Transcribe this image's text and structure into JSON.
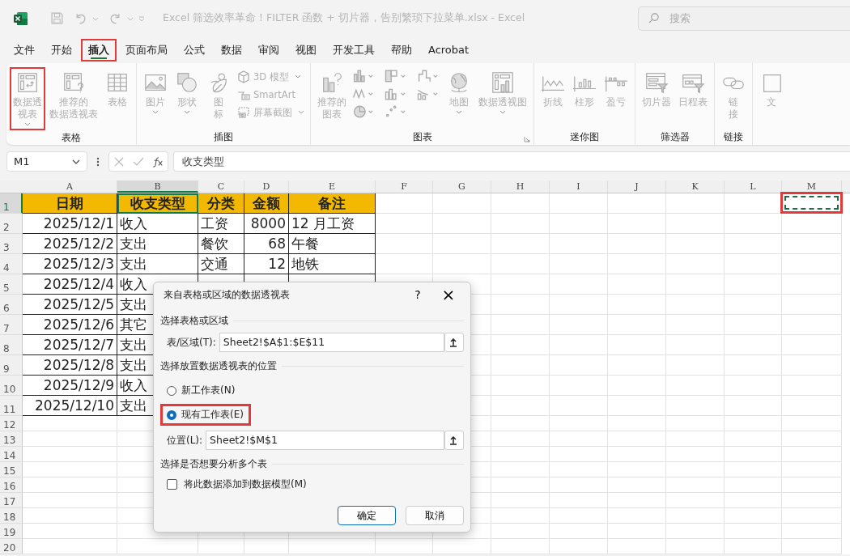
{
  "window": {
    "title": "Excel 筛选效率革命！FILTER 函数 + 切片器，告别繁琐下拉菜单.xlsx  -  Excel",
    "search_placeholder": "搜索"
  },
  "tabs": [
    {
      "label": "文件",
      "selected": false,
      "highlighted": false
    },
    {
      "label": "开始",
      "selected": false,
      "highlighted": false
    },
    {
      "label": "插入",
      "selected": true,
      "highlighted": true
    },
    {
      "label": "页面布局",
      "selected": false,
      "highlighted": false
    },
    {
      "label": "公式",
      "selected": false,
      "highlighted": false
    },
    {
      "label": "数据",
      "selected": false,
      "highlighted": false
    },
    {
      "label": "审阅",
      "selected": false,
      "highlighted": false
    },
    {
      "label": "视图",
      "selected": false,
      "highlighted": false
    },
    {
      "label": "开发工具",
      "selected": false,
      "highlighted": false
    },
    {
      "label": "帮助",
      "selected": false,
      "highlighted": false
    },
    {
      "label": "Acrobat",
      "selected": false,
      "highlighted": false
    }
  ],
  "ribbon": {
    "disabled": true,
    "groups": [
      {
        "label": "表格",
        "buttons": [
          {
            "lines": [
              "数据透",
              "视表"
            ],
            "dropdown": true,
            "highlighted": true
          },
          {
            "lines": [
              "推荐的",
              "数据透视表"
            ],
            "dropdown": false,
            "highlighted": false
          },
          {
            "lines": [
              "表格"
            ],
            "dropdown": false,
            "highlighted": false
          }
        ]
      },
      {
        "label": "插图",
        "buttons": [
          {
            "lines": [
              "图片"
            ],
            "dropdown": true,
            "highlighted": false
          },
          {
            "lines": [
              "形状"
            ],
            "dropdown": true,
            "highlighted": false
          },
          {
            "lines": [
              "图",
              "标"
            ],
            "dropdown": false,
            "highlighted": false
          }
        ],
        "small": [
          {
            "label": "3D 模型",
            "dropdown": true
          },
          {
            "label": "SmartArt",
            "dropdown": false
          },
          {
            "label": "屏幕截图",
            "dropdown": true
          }
        ]
      },
      {
        "label": "图表",
        "buttons": [
          {
            "lines": [
              "推荐的",
              "图表"
            ],
            "dropdown": false,
            "highlighted": false
          },
          {
            "lines": [
              "地图"
            ],
            "dropdown": true,
            "highlighted": false
          },
          {
            "lines": [
              "数据透视图"
            ],
            "dropdown": true,
            "highlighted": false
          }
        ]
      },
      {
        "label": "迷你图",
        "buttons": [
          {
            "lines": [
              "折线"
            ],
            "dropdown": false,
            "highlighted": false
          },
          {
            "lines": [
              "柱形"
            ],
            "dropdown": false,
            "highlighted": false
          },
          {
            "lines": [
              "盈亏"
            ],
            "dropdown": false,
            "highlighted": false
          }
        ]
      },
      {
        "label": "筛选器",
        "buttons": [
          {
            "lines": [
              "切片器"
            ],
            "dropdown": false,
            "highlighted": false
          },
          {
            "lines": [
              "日程表"
            ],
            "dropdown": false,
            "highlighted": false
          }
        ]
      },
      {
        "label": "链接",
        "buttons": [
          {
            "lines": [
              "链",
              "接"
            ],
            "dropdown": false,
            "highlighted": false
          }
        ]
      },
      {
        "buttons": [
          {
            "lines": [
              "文"
            ],
            "dropdown": false,
            "highlighted": false
          }
        ]
      }
    ]
  },
  "formula_bar": {
    "name_box": "M1",
    "formula": "收支类型"
  },
  "sheet": {
    "columns": [
      {
        "letter": "A",
        "kind": "date",
        "selected": false
      },
      {
        "letter": "B",
        "kind": "text",
        "selected": true
      },
      {
        "letter": "C",
        "kind": "text",
        "selected": false
      },
      {
        "letter": "D",
        "kind": "number",
        "selected": false
      },
      {
        "letter": "E",
        "kind": "text",
        "selected": false
      },
      {
        "letter": "F",
        "selected": false
      },
      {
        "letter": "G",
        "selected": false
      },
      {
        "letter": "H",
        "selected": false
      },
      {
        "letter": "I",
        "selected": false
      },
      {
        "letter": "J",
        "selected": false
      },
      {
        "letter": "K",
        "selected": false
      },
      {
        "letter": "L",
        "selected": false
      },
      {
        "letter": "M",
        "selected": false,
        "marquee": {
          "highlighted": true
        }
      }
    ],
    "rows": [
      {
        "number": "1",
        "selected": true,
        "header": true,
        "marquee": true,
        "cells": [
          "日期",
          "收支类型",
          "分类",
          "金额",
          "备注"
        ]
      },
      {
        "number": "2",
        "selected": false,
        "cells": [
          "2025/12/1",
          "收入",
          "工资",
          "8000",
          "12  月工资"
        ]
      },
      {
        "number": "3",
        "selected": false,
        "cells": [
          "2025/12/2",
          "支出",
          "餐饮",
          "68",
          "午餐"
        ]
      },
      {
        "number": "4",
        "selected": false,
        "cells": [
          "2025/12/3",
          "支出",
          "交通",
          "12",
          "地铁"
        ]
      },
      {
        "number": "5",
        "selected": false,
        "cells": [
          "2025/12/4",
          "收入"
        ]
      },
      {
        "number": "6",
        "selected": false,
        "cells": [
          "2025/12/5",
          "支出"
        ]
      },
      {
        "number": "7",
        "selected": false,
        "cells": [
          "2025/12/6",
          "其它"
        ]
      },
      {
        "number": "8",
        "selected": false,
        "cells": [
          "2025/12/7",
          "支出"
        ]
      },
      {
        "number": "9",
        "selected": false,
        "cells": [
          "2025/12/8",
          "支出"
        ]
      },
      {
        "number": "10",
        "selected": false,
        "cells": [
          "2025/12/9",
          "收入"
        ]
      },
      {
        "number": "11",
        "selected": false,
        "cells": [
          "2025/12/10",
          "支出"
        ]
      },
      {
        "number": "12",
        "selected": false
      },
      {
        "number": "13",
        "selected": false
      },
      {
        "number": "14",
        "selected": false
      },
      {
        "number": "15",
        "selected": false
      },
      {
        "number": "16",
        "selected": false
      },
      {
        "number": "17",
        "selected": false
      },
      {
        "number": "18",
        "selected": false
      },
      {
        "number": "19",
        "selected": false
      },
      {
        "number": "20",
        "selected": false
      }
    ]
  },
  "dialog": {
    "title": "来自表格或区域的数据透视表",
    "help": "?",
    "close": "×",
    "section_1": "选择表格或区域",
    "range_label": "表/区域(T):",
    "range_value": "Sheet2!$A$1:$E$11",
    "section_2": "选择放置数据透视表的位置",
    "options": [
      {
        "label": "新工作表(N)",
        "selected": false,
        "highlighted": false
      },
      {
        "label": "现有工作表(E)",
        "selected": true,
        "highlighted": true
      }
    ],
    "location_label": "位置(L):",
    "location_value": "Sheet2!$M$1",
    "section_3": "选择是否想要分析多个表",
    "checkbox": {
      "label": "将此数据添加到数据模型(M)",
      "checked": false
    },
    "buttons": [
      {
        "label": "确定",
        "kind": "default"
      },
      {
        "label": "取消",
        "kind": "normal"
      }
    ]
  }
}
